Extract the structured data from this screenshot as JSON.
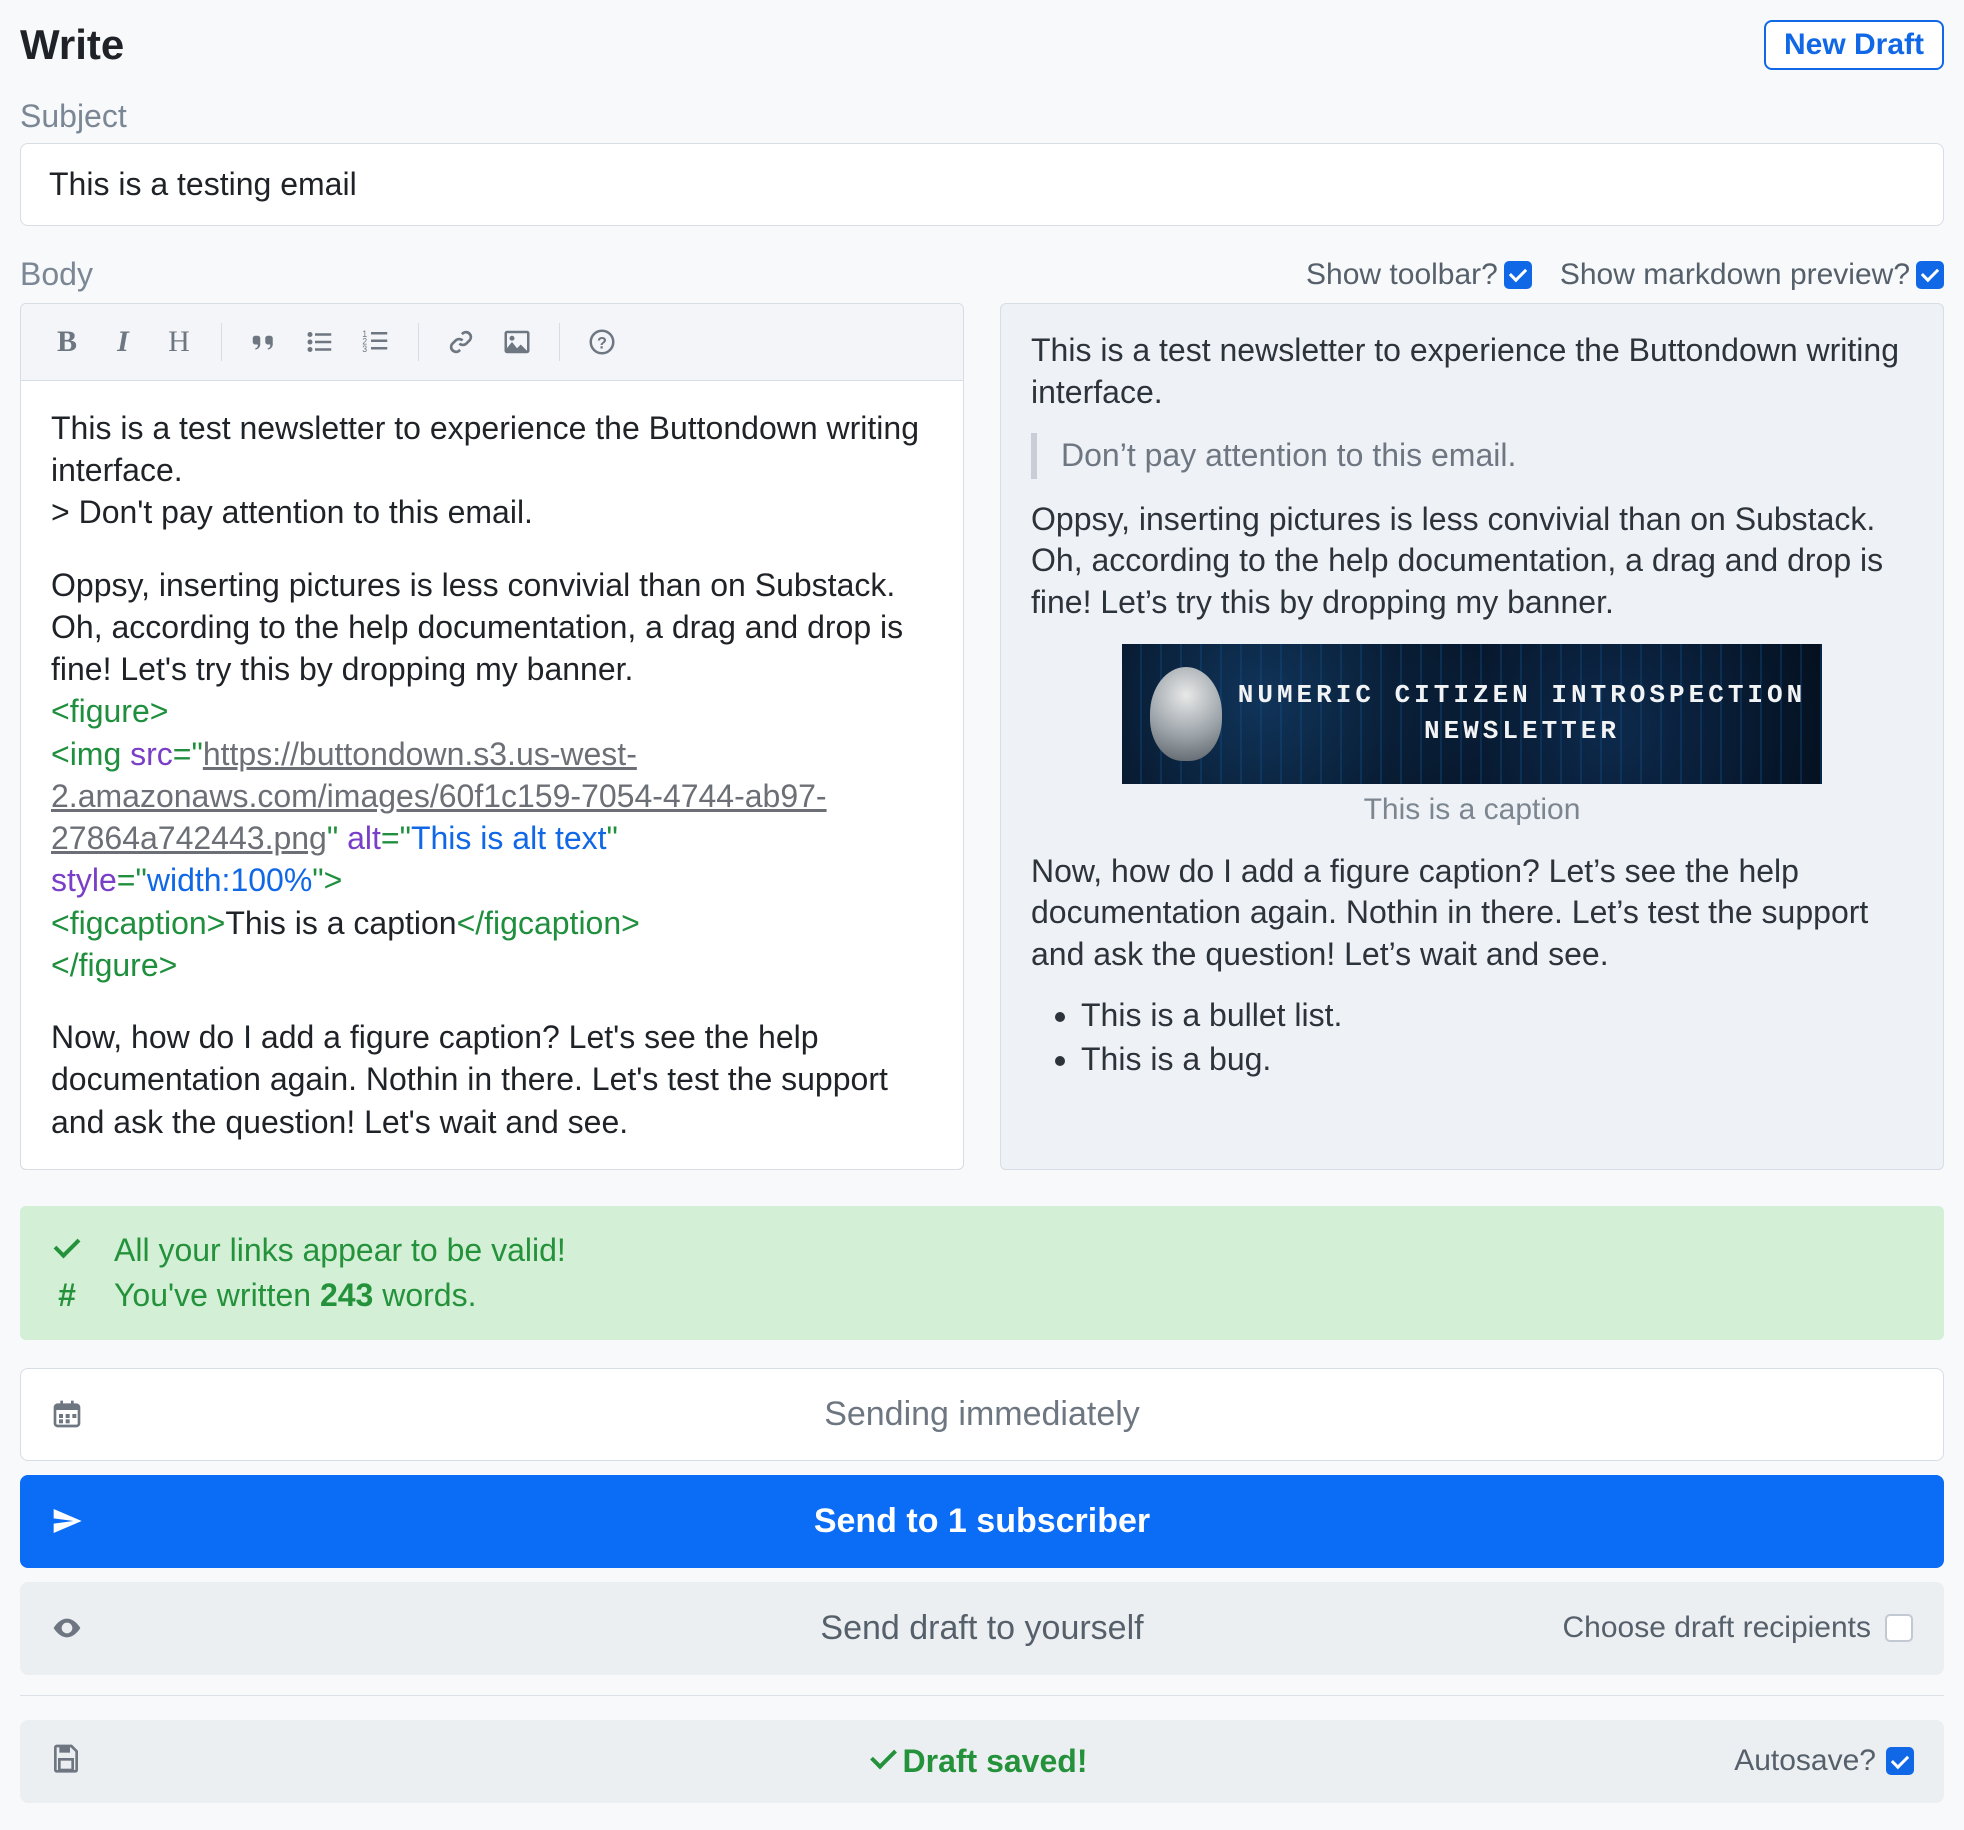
{
  "header": {
    "title": "Write",
    "new_draft": "New Draft"
  },
  "subject": {
    "label": "Subject",
    "value": "This is a testing email"
  },
  "body": {
    "label": "Body",
    "toggles": {
      "toolbar": "Show toolbar?",
      "preview": "Show markdown preview?"
    },
    "editor": {
      "p1": "This is a test newsletter to experience the Buttondown writing interface.",
      "quote_line": "> Don't pay attention to this email.",
      "p2": "Oppsy, inserting pictures is less convivial than on Substack. Oh, according to the help documentation, a drag and drop is fine! Let's try this by dropping my banner.",
      "figure_open": "<figure>",
      "img_prefix": "  <img ",
      "src_attr": "src",
      "src_eq": "=\"",
      "src_url": "https://buttondown.s3.us-west-2.amazonaws.com/images/60f1c159-7054-4744-ab97-27864a742443.png",
      "src_close_space": "\" ",
      "alt_attr": "alt",
      "alt_eq_q": "=\"",
      "alt_val": "This is alt text",
      "alt_close_q": "\"",
      "style_attr": "style",
      "style_eq_q": "=\"",
      "style_val": "width:100%",
      "style_close": "\">",
      "figcap_open": "  <figcaption>",
      "figcap_text": "This is a caption",
      "figcap_close": "</figcaption>",
      "figure_close": "</figure>",
      "p3": " Now, how do I add a figure caption? Let's see the help documentation again. Nothin in there. Let's test the support and ask the question! Let's wait and see."
    },
    "preview": {
      "p1": "This is a test newsletter to experience the Buttondown writing interface.",
      "blockquote": "Don’t pay attention to this email.",
      "p2": "Oppsy, inserting pictures is less convivial than on Substack. Oh, according to the help documentation, a drag and drop is fine! Let’s try this by dropping my banner.",
      "banner_line1": "NUMERIC CITIZEN INTROSPECTION",
      "banner_line2": "NEWSLETTER",
      "caption": "This is a caption",
      "p3": "Now, how do I add a figure caption? Let’s see the help documentation again. Nothin in there. Let’s test the support and ask the question! Let’s wait and see.",
      "bullets": [
        "This is a bullet list.",
        "This is a bug."
      ]
    }
  },
  "status": {
    "links_valid": "All your links appear to be valid!",
    "words_pre": "You've written ",
    "word_count": "243",
    "words_post": " words."
  },
  "actions": {
    "schedule": "Sending immediately",
    "send": "Send to 1 subscriber",
    "draft_self": "Send draft to yourself",
    "choose_recipients": "Choose draft recipients"
  },
  "save": {
    "saved": "Draft saved!",
    "autosave": "Autosave?"
  },
  "toolbar_icons": {
    "bold": "B",
    "italic": "I",
    "heading": "H",
    "quote": "“”"
  }
}
